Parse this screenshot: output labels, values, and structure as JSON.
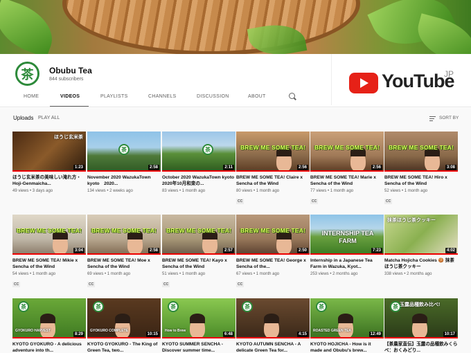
{
  "channel": {
    "avatar_glyph": "茶",
    "name": "Obubu Tea",
    "subscribers": "844 subscribers"
  },
  "logo": {
    "word": "YouTube",
    "region": "JP",
    "color": "#e62117"
  },
  "tabs": [
    "HOME",
    "VIDEOS",
    "PLAYLISTS",
    "CHANNELS",
    "DISCUSSION",
    "ABOUT"
  ],
  "active_tab": "VIDEOS",
  "section": {
    "title": "Uploads",
    "play_all": "PLAY ALL",
    "sort": "SORT BY"
  },
  "videos": [
    {
      "title": "ほうじ玄米茶の美味しい淹れ方・Hoji-Genmaicha...",
      "views": "49 views",
      "age": "3 days ago",
      "duration": "1:23",
      "cc": false,
      "overlay": "ほうじ玄米茶",
      "brew": ""
    },
    {
      "title": "November 2020 WazukaTown kyoto　2020...",
      "views": "134 views",
      "age": "2 weeks ago",
      "duration": "2:58",
      "cc": false,
      "overlay": "",
      "brew": ""
    },
    {
      "title": "October 2020 WazukaTown kyoto　2020年10月和束の...",
      "views": "83 views",
      "age": "1 month ago",
      "duration": "2:11",
      "cc": false,
      "overlay": "",
      "brew": ""
    },
    {
      "title": "BREW ME SOME TEA! Claire x Sencha of the Wind",
      "views": "80 views",
      "age": "1 month ago",
      "duration": "2:56",
      "cc": true,
      "overlay": "",
      "brew": "BREW ME SOME TEA!"
    },
    {
      "title": "BREW ME SOME TEA! Marie x Sencha of the Wind",
      "views": "77 views",
      "age": "1 month ago",
      "duration": "2:56",
      "cc": true,
      "overlay": "",
      "brew": "BREW ME SOME TEA!"
    },
    {
      "title": "BREW ME SOME TEA! Hiro x Sencha of the Wind",
      "views": "52 views",
      "age": "1 month ago",
      "duration": "3:08",
      "cc": true,
      "overlay": "",
      "brew": "BREW ME SOME TEA!"
    },
    {
      "title": "BREW ME SOME TEA! Mikie x Sencha of the Wind",
      "views": "54 views",
      "age": "1 month ago",
      "duration": "3:04",
      "cc": true,
      "overlay": "",
      "brew": "BREW ME SOME TEA!"
    },
    {
      "title": "BREW ME SOME TEA! Moe x Sencha of the Wind",
      "views": "69 views",
      "age": "1 month ago",
      "duration": "2:58",
      "cc": true,
      "overlay": "",
      "brew": "BREW ME SOME TEA!"
    },
    {
      "title": "BREW ME SOME TEA! Kayo x Sencha of the Wind",
      "views": "51 views",
      "age": "1 month ago",
      "duration": "2:57",
      "cc": true,
      "overlay": "",
      "brew": "BREW ME SOME TEA!"
    },
    {
      "title": "BREW ME SOME TEA! George x Sencha of the...",
      "views": "67 views",
      "age": "1 month ago",
      "duration": "2:50",
      "cc": true,
      "overlay": "",
      "brew": "BREW ME SOME TEA!"
    },
    {
      "title": "Internship in a Japanese Tea Farm in Wazuka, Kyot...",
      "views": "253 views",
      "age": "2 months ago",
      "duration": "7:23",
      "cc": false,
      "overlay": "INTERNSHIP TEA FARM",
      "brew": ""
    },
    {
      "title": "Matcha Hojicha Cookies 🍪 抹茶ほうじ茶クッキー",
      "views": "338 views",
      "age": "2 months ago",
      "duration": "4:02",
      "cc": false,
      "overlay": "抹茶ほうじ茶クッキー",
      "brew": ""
    },
    {
      "title": "KYOTO GYOKURO - A delicious adventure into th...",
      "views": "",
      "age": "",
      "duration": "8:29",
      "cc": false,
      "overlay": "GYOKURO HARVEST",
      "brew": ""
    },
    {
      "title": "KYOTO GYOKURO - The King of Green Tea, two...",
      "views": "",
      "age": "",
      "duration": "10:15",
      "cc": false,
      "overlay": "GYOKURO COMPLETE",
      "brew": ""
    },
    {
      "title": "KYOTO SUMMER SENCHA - Discover summer time...",
      "views": "",
      "age": "",
      "duration": "6:48",
      "cc": false,
      "overlay": "How to Brew",
      "brew": ""
    },
    {
      "title": "KYOTO AUTUMN SENCHA - A delicate Green Tea for...",
      "views": "",
      "age": "",
      "duration": "4:15",
      "cc": false,
      "overlay": "",
      "brew": ""
    },
    {
      "title": "KYOTO HOJICHA - How is it made and Obubu's brew...",
      "views": "",
      "age": "",
      "duration": "12:49",
      "cc": false,
      "overlay": "ROASTED GREEN TEA",
      "brew": ""
    },
    {
      "title": "【茶農家直伝】玉露の品種飲みくらべ：おくみどり...",
      "views": "",
      "age": "",
      "duration": "10:17",
      "cc": false,
      "overlay": "玉露品種飲み比べ!",
      "brew": ""
    }
  ]
}
